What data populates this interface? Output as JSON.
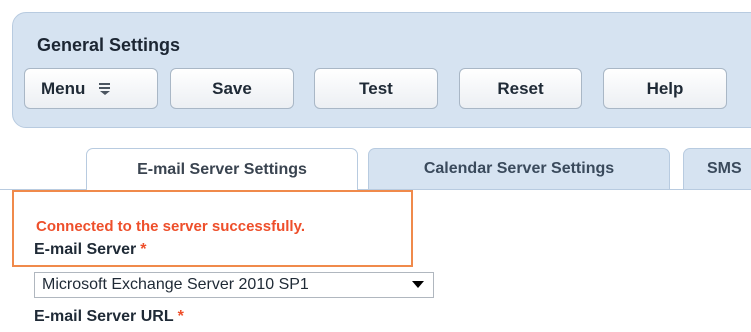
{
  "header": {
    "title": "General Settings"
  },
  "toolbar": {
    "menu_label": "Menu",
    "save_label": "Save",
    "test_label": "Test",
    "reset_label": "Reset",
    "help_label": "Help"
  },
  "tabs": [
    {
      "label": "E-mail Server Settings",
      "active": true
    },
    {
      "label": "Calendar Server Settings",
      "active": false
    },
    {
      "label": "SMS",
      "active": false
    }
  ],
  "alert": {
    "message": "Connected to the server successfully."
  },
  "form": {
    "email_server_label": "E-mail Server",
    "email_server_required": "*",
    "email_server_value": "Microsoft Exchange Server 2010 SP1",
    "email_server_url_label": "E-mail Server URL",
    "email_server_url_required": "*"
  },
  "colors": {
    "panel_background": "#d6e3f1",
    "alert_border": "#f08a4b",
    "alert_text": "#ee4f2b"
  }
}
